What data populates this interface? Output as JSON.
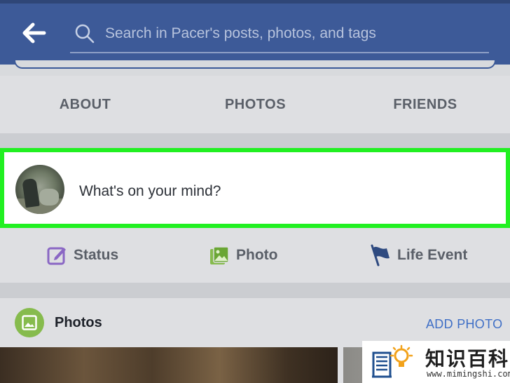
{
  "header": {
    "back_icon": "arrow-left-icon",
    "search": {
      "placeholder": "Search in Pacer's posts, photos, and tags",
      "value": ""
    },
    "colors": {
      "bar": "#3d5a98"
    }
  },
  "tabs": [
    {
      "label": "ABOUT"
    },
    {
      "label": "PHOTOS"
    },
    {
      "label": "FRIENDS"
    }
  ],
  "composer": {
    "prompt": "What's on your mind?",
    "highlight_color": "#21f021"
  },
  "actions": [
    {
      "label": "Status",
      "icon": "edit-icon"
    },
    {
      "label": "Photo",
      "icon": "photo-icon"
    },
    {
      "label": "Life Event",
      "icon": "flag-icon"
    }
  ],
  "photos_section": {
    "title": "Photos",
    "add_label": "ADD PHOTO"
  },
  "watermark": {
    "title": "知识百科",
    "url": "www.mimingshi.com"
  }
}
